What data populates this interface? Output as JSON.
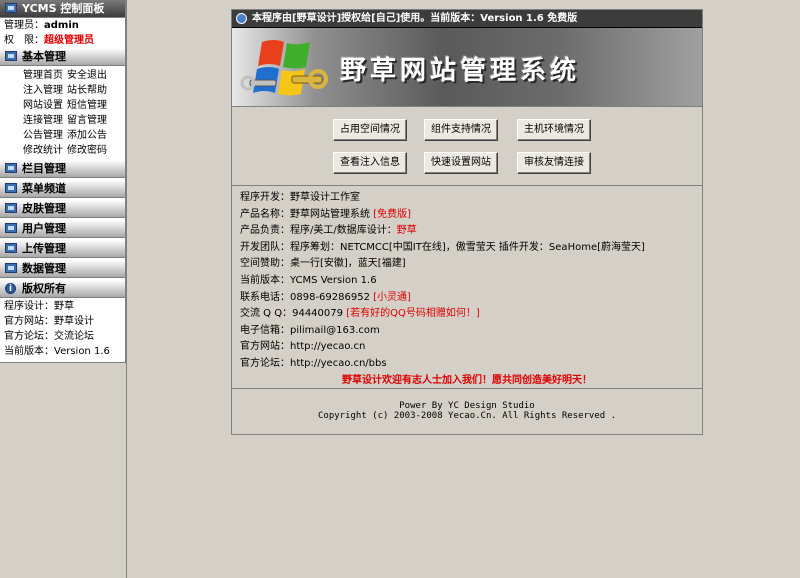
{
  "sidebar": {
    "panel_title": "YCMS 控制面板",
    "admin_label": "管理员：",
    "admin_name": "admin",
    "perm_label": "权　限：",
    "perm_value": "超级管理员",
    "basic_title": "基本管理",
    "basic_rows": [
      [
        "管理首页",
        "安全退出"
      ],
      [
        "注入管理",
        "站长帮助"
      ],
      [
        "网站设置",
        "短信管理"
      ],
      [
        "连接管理",
        "留言管理"
      ],
      [
        "公告管理",
        "添加公告"
      ],
      [
        "修改统计",
        "修改密码"
      ]
    ],
    "sections": [
      "栏目管理",
      "菜单频道",
      "皮肤管理",
      "用户管理",
      "上传管理",
      "数据管理"
    ],
    "copyright_title": "版权所有",
    "copyright_rows": [
      "程序设计：野草",
      "官方网站：野草设计",
      "官方论坛：交流论坛",
      "当前版本：Version 1.6"
    ]
  },
  "main": {
    "notice": "本程序由[野草设计]授权给[自己]使用。当前版本：Version 1.6 免费版",
    "banner_title": "野草网站管理系统",
    "buttons": [
      "占用空间情况",
      "组件支持情况",
      "主机环境情况",
      "查看注入信息",
      "快速设置网站",
      "审核友情连接"
    ],
    "info": {
      "dev": "程序开发：野草设计工作室",
      "product_a": "产品名称：野草网站管理系统 ",
      "product_b": "[免费版]",
      "lead_a": "产品负责：程序/美工/数据库设计：",
      "lead_b": "野草",
      "team": "开发团队：程序筹划：NETCMCC[中国IT在线]，傲雪莹天 插件开发：SeaHome[蔚海莹天]",
      "sponsor": "空间赞助：桌一行[安徽]，蓝天[福建]",
      "version": "当前版本：YCMS Version 1.6",
      "phone_a": "联系电话：0898-69286952 ",
      "phone_b": "[小灵通]",
      "qq_a": "交流 Q Q：94440079 ",
      "qq_b": "[若有好的QQ号码相赠如何！]",
      "email": "电子信箱：pilimail@163.com",
      "site": "官方网站：http://yecao.cn",
      "forum": "官方论坛：http://yecao.cn/bbs",
      "welcome": "野草设计欢迎有志人士加入我们！愿共同创造美好明天！"
    },
    "footer_1": "Power By YC Design Studio",
    "footer_2": "Copyright (c) 2003-2008 Yecao.Cn. All Rights Reserved ."
  }
}
